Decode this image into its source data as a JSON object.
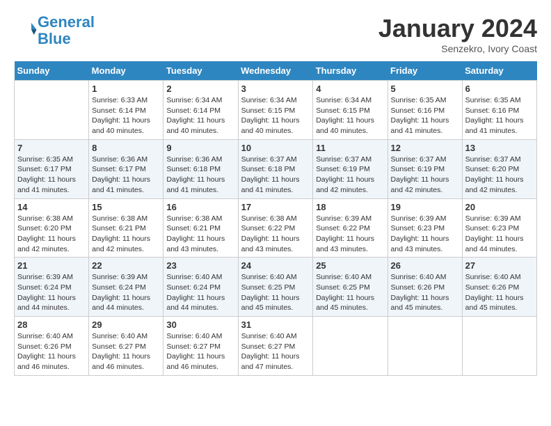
{
  "header": {
    "logo_line1": "General",
    "logo_line2": "Blue",
    "month": "January 2024",
    "location": "Senzekro, Ivory Coast"
  },
  "days_of_week": [
    "Sunday",
    "Monday",
    "Tuesday",
    "Wednesday",
    "Thursday",
    "Friday",
    "Saturday"
  ],
  "weeks": [
    [
      {
        "day": "",
        "info": ""
      },
      {
        "day": "1",
        "info": "Sunrise: 6:33 AM\nSunset: 6:14 PM\nDaylight: 11 hours\nand 40 minutes."
      },
      {
        "day": "2",
        "info": "Sunrise: 6:34 AM\nSunset: 6:14 PM\nDaylight: 11 hours\nand 40 minutes."
      },
      {
        "day": "3",
        "info": "Sunrise: 6:34 AM\nSunset: 6:15 PM\nDaylight: 11 hours\nand 40 minutes."
      },
      {
        "day": "4",
        "info": "Sunrise: 6:34 AM\nSunset: 6:15 PM\nDaylight: 11 hours\nand 40 minutes."
      },
      {
        "day": "5",
        "info": "Sunrise: 6:35 AM\nSunset: 6:16 PM\nDaylight: 11 hours\nand 41 minutes."
      },
      {
        "day": "6",
        "info": "Sunrise: 6:35 AM\nSunset: 6:16 PM\nDaylight: 11 hours\nand 41 minutes."
      }
    ],
    [
      {
        "day": "7",
        "info": "Sunrise: 6:35 AM\nSunset: 6:17 PM\nDaylight: 11 hours\nand 41 minutes."
      },
      {
        "day": "8",
        "info": "Sunrise: 6:36 AM\nSunset: 6:17 PM\nDaylight: 11 hours\nand 41 minutes."
      },
      {
        "day": "9",
        "info": "Sunrise: 6:36 AM\nSunset: 6:18 PM\nDaylight: 11 hours\nand 41 minutes."
      },
      {
        "day": "10",
        "info": "Sunrise: 6:37 AM\nSunset: 6:18 PM\nDaylight: 11 hours\nand 41 minutes."
      },
      {
        "day": "11",
        "info": "Sunrise: 6:37 AM\nSunset: 6:19 PM\nDaylight: 11 hours\nand 42 minutes."
      },
      {
        "day": "12",
        "info": "Sunrise: 6:37 AM\nSunset: 6:19 PM\nDaylight: 11 hours\nand 42 minutes."
      },
      {
        "day": "13",
        "info": "Sunrise: 6:37 AM\nSunset: 6:20 PM\nDaylight: 11 hours\nand 42 minutes."
      }
    ],
    [
      {
        "day": "14",
        "info": "Sunrise: 6:38 AM\nSunset: 6:20 PM\nDaylight: 11 hours\nand 42 minutes."
      },
      {
        "day": "15",
        "info": "Sunrise: 6:38 AM\nSunset: 6:21 PM\nDaylight: 11 hours\nand 42 minutes."
      },
      {
        "day": "16",
        "info": "Sunrise: 6:38 AM\nSunset: 6:21 PM\nDaylight: 11 hours\nand 43 minutes."
      },
      {
        "day": "17",
        "info": "Sunrise: 6:38 AM\nSunset: 6:22 PM\nDaylight: 11 hours\nand 43 minutes."
      },
      {
        "day": "18",
        "info": "Sunrise: 6:39 AM\nSunset: 6:22 PM\nDaylight: 11 hours\nand 43 minutes."
      },
      {
        "day": "19",
        "info": "Sunrise: 6:39 AM\nSunset: 6:23 PM\nDaylight: 11 hours\nand 43 minutes."
      },
      {
        "day": "20",
        "info": "Sunrise: 6:39 AM\nSunset: 6:23 PM\nDaylight: 11 hours\nand 44 minutes."
      }
    ],
    [
      {
        "day": "21",
        "info": "Sunrise: 6:39 AM\nSunset: 6:24 PM\nDaylight: 11 hours\nand 44 minutes."
      },
      {
        "day": "22",
        "info": "Sunrise: 6:39 AM\nSunset: 6:24 PM\nDaylight: 11 hours\nand 44 minutes."
      },
      {
        "day": "23",
        "info": "Sunrise: 6:40 AM\nSunset: 6:24 PM\nDaylight: 11 hours\nand 44 minutes."
      },
      {
        "day": "24",
        "info": "Sunrise: 6:40 AM\nSunset: 6:25 PM\nDaylight: 11 hours\nand 45 minutes."
      },
      {
        "day": "25",
        "info": "Sunrise: 6:40 AM\nSunset: 6:25 PM\nDaylight: 11 hours\nand 45 minutes."
      },
      {
        "day": "26",
        "info": "Sunrise: 6:40 AM\nSunset: 6:26 PM\nDaylight: 11 hours\nand 45 minutes."
      },
      {
        "day": "27",
        "info": "Sunrise: 6:40 AM\nSunset: 6:26 PM\nDaylight: 11 hours\nand 45 minutes."
      }
    ],
    [
      {
        "day": "28",
        "info": "Sunrise: 6:40 AM\nSunset: 6:26 PM\nDaylight: 11 hours\nand 46 minutes."
      },
      {
        "day": "29",
        "info": "Sunrise: 6:40 AM\nSunset: 6:27 PM\nDaylight: 11 hours\nand 46 minutes."
      },
      {
        "day": "30",
        "info": "Sunrise: 6:40 AM\nSunset: 6:27 PM\nDaylight: 11 hours\nand 46 minutes."
      },
      {
        "day": "31",
        "info": "Sunrise: 6:40 AM\nSunset: 6:27 PM\nDaylight: 11 hours\nand 47 minutes."
      },
      {
        "day": "",
        "info": ""
      },
      {
        "day": "",
        "info": ""
      },
      {
        "day": "",
        "info": ""
      }
    ]
  ]
}
